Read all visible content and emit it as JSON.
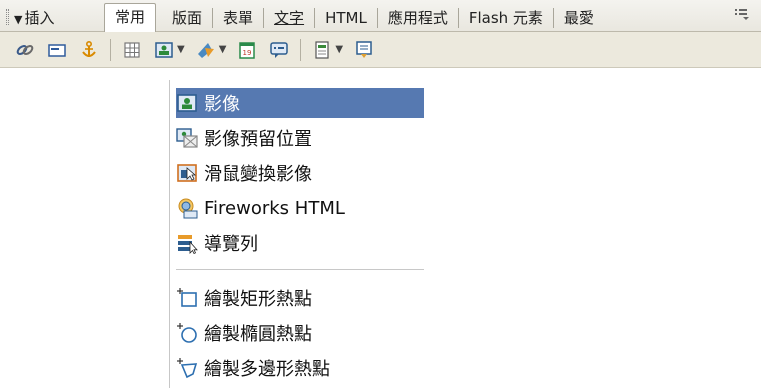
{
  "panel": {
    "title": "插入",
    "tabs": [
      {
        "label": "常用"
      },
      {
        "label": "版面"
      },
      {
        "label": "表單"
      },
      {
        "label": "文字"
      },
      {
        "label": "HTML"
      },
      {
        "label": "應用程式"
      },
      {
        "label": "Flash 元素"
      },
      {
        "label": "最愛"
      }
    ],
    "toolbar_icons": [
      "hyperlink-icon",
      "email-link-icon",
      "named-anchor-icon",
      "table-icon",
      "image-icon",
      "media-icon",
      "date-icon",
      "comment-icon",
      "template-icon",
      "tag-chooser-icon"
    ]
  },
  "dropdown": {
    "items": [
      {
        "label": "影像",
        "icon": "image-icon",
        "selected": true
      },
      {
        "label": "影像預留位置",
        "icon": "image-placeholder-icon"
      },
      {
        "label": "滑鼠變換影像",
        "icon": "rollover-image-icon"
      },
      {
        "label": "Fireworks HTML",
        "icon": "fireworks-html-icon"
      },
      {
        "label": "導覽列",
        "icon": "navigation-bar-icon"
      },
      {
        "label": "繪製矩形熱點",
        "icon": "rectangle-hotspot-icon"
      },
      {
        "label": "繪製橢圓熱點",
        "icon": "oval-hotspot-icon"
      },
      {
        "label": "繪製多邊形熱點",
        "icon": "polygon-hotspot-icon"
      }
    ]
  },
  "colors": {
    "selection": "#5679b1",
    "toolbar_bg": "#ece9dd"
  }
}
